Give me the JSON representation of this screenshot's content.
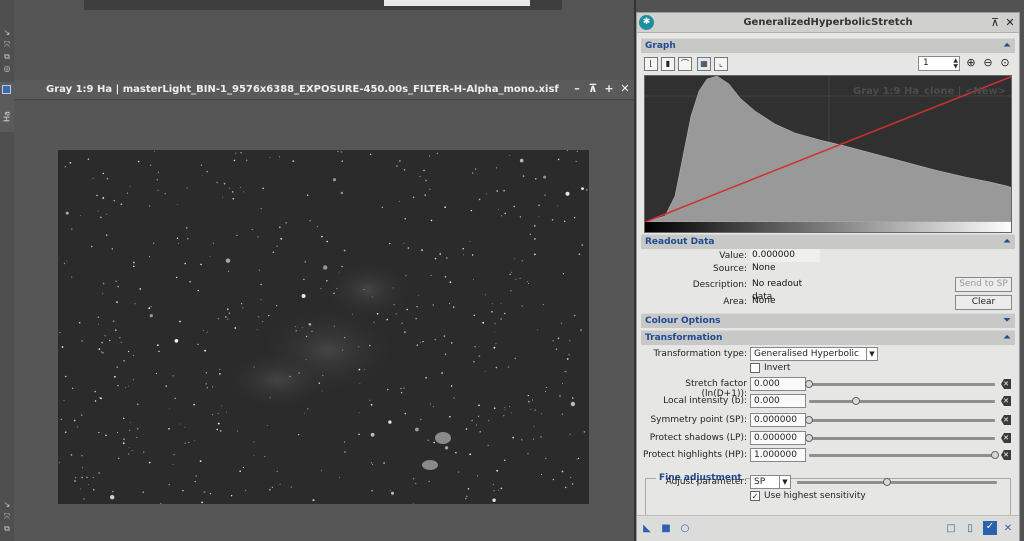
{
  "image_window": {
    "title": "Gray 1:9 Ha | masterLight_BIN-1_9576x6388_EXPOSURE-450.00s_FILTER-H-Alpha_mono.xisf",
    "side_tab_label": "Ha"
  },
  "ghs": {
    "title": "GeneralizedHyperbolicStretch",
    "graph_section": "Graph",
    "zoom_value": "1",
    "graph_ghost_text": "Gray 1:9 Ha_clone | <New>",
    "readout_section": "Readout Data",
    "readout": {
      "value_label": "Value:",
      "value": "0.000000",
      "source_label": "Source:",
      "source": "None",
      "description_label": "Description:",
      "description": "No readout data",
      "area_label": "Area:",
      "area": "None",
      "send_button": "Send to SP",
      "clear_button": "Clear"
    },
    "colour_section": "Colour Options",
    "transformation_section": "Transformation",
    "transformation": {
      "type_label": "Transformation type:",
      "type_value": "Generalised Hyperbolic",
      "invert_label": "Invert",
      "params": [
        {
          "label": "Stretch factor (ln(D+1)):",
          "value": "0.000",
          "level": 0.0
        },
        {
          "label": "Local intensity (b):",
          "value": "0.000",
          "level": 0.25
        },
        {
          "label": "Symmetry point (SP):",
          "value": "0.000000",
          "level": 0.0
        },
        {
          "label": "Protect shadows (LP):",
          "value": "0.000000",
          "level": 0.0
        },
        {
          "label": "Protect highlights (HP):",
          "value": "1.000000",
          "level": 1.0
        }
      ]
    },
    "fine": {
      "legend": "Fine adjustment",
      "param_label": "Adjust parameter:",
      "param_value": "SP",
      "sensitivity_label": "Use highest sensitivity",
      "level": 0.45
    }
  },
  "colors": {
    "accent": "#1f4b93",
    "curve": "#d03030",
    "histogram": "#9a9a9a"
  }
}
